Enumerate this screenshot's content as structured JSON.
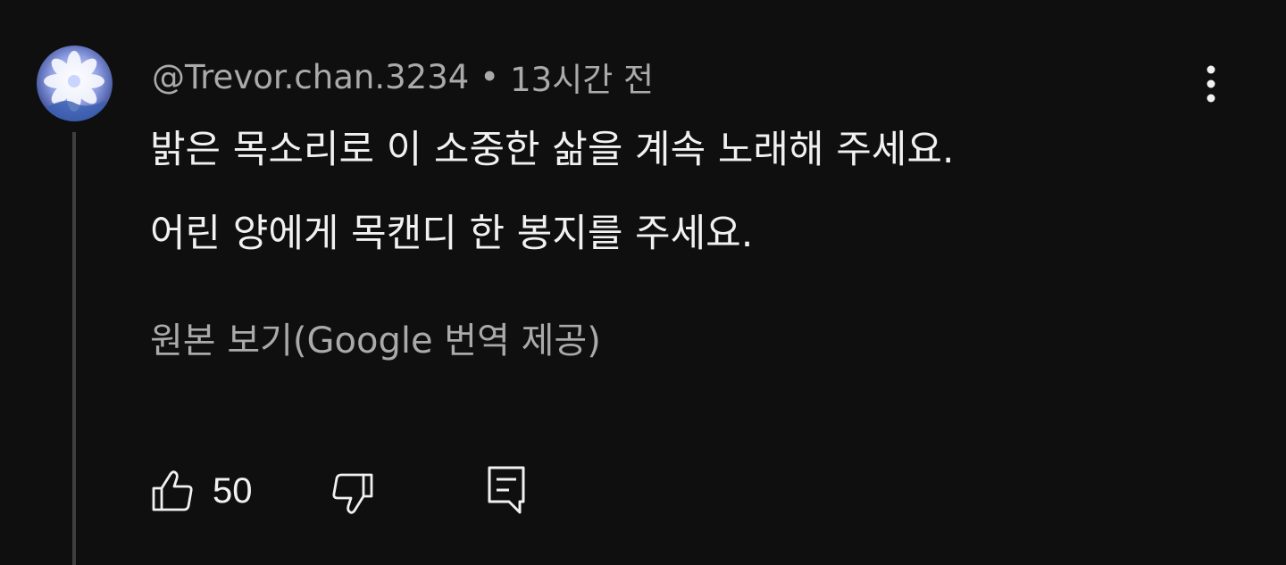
{
  "comment": {
    "author": "@Trevor.chan.3234",
    "separator": "•",
    "timestamp": "13시간 전",
    "text_lines": [
      "밝은 목소리로 이 소중한 삶을 계속 노래해 주세요.",
      "어린 양에게 목캔디 한 봉지를 주세요."
    ],
    "translation_link": "원본 보기(Google 번역 제공)",
    "like_count": "50",
    "avatar_icon": "flower-avatar",
    "menu_icon": "more-vertical-icon"
  },
  "actions": {
    "like_icon": "thumbs-up-icon",
    "dislike_icon": "thumbs-down-icon",
    "reply_icon": "reply-comment-icon"
  },
  "colors": {
    "background": "#0f0f0f",
    "primary_text": "#f1f1f1",
    "secondary_text": "#aaaaaa",
    "thread_line": "#3f3f3f"
  }
}
